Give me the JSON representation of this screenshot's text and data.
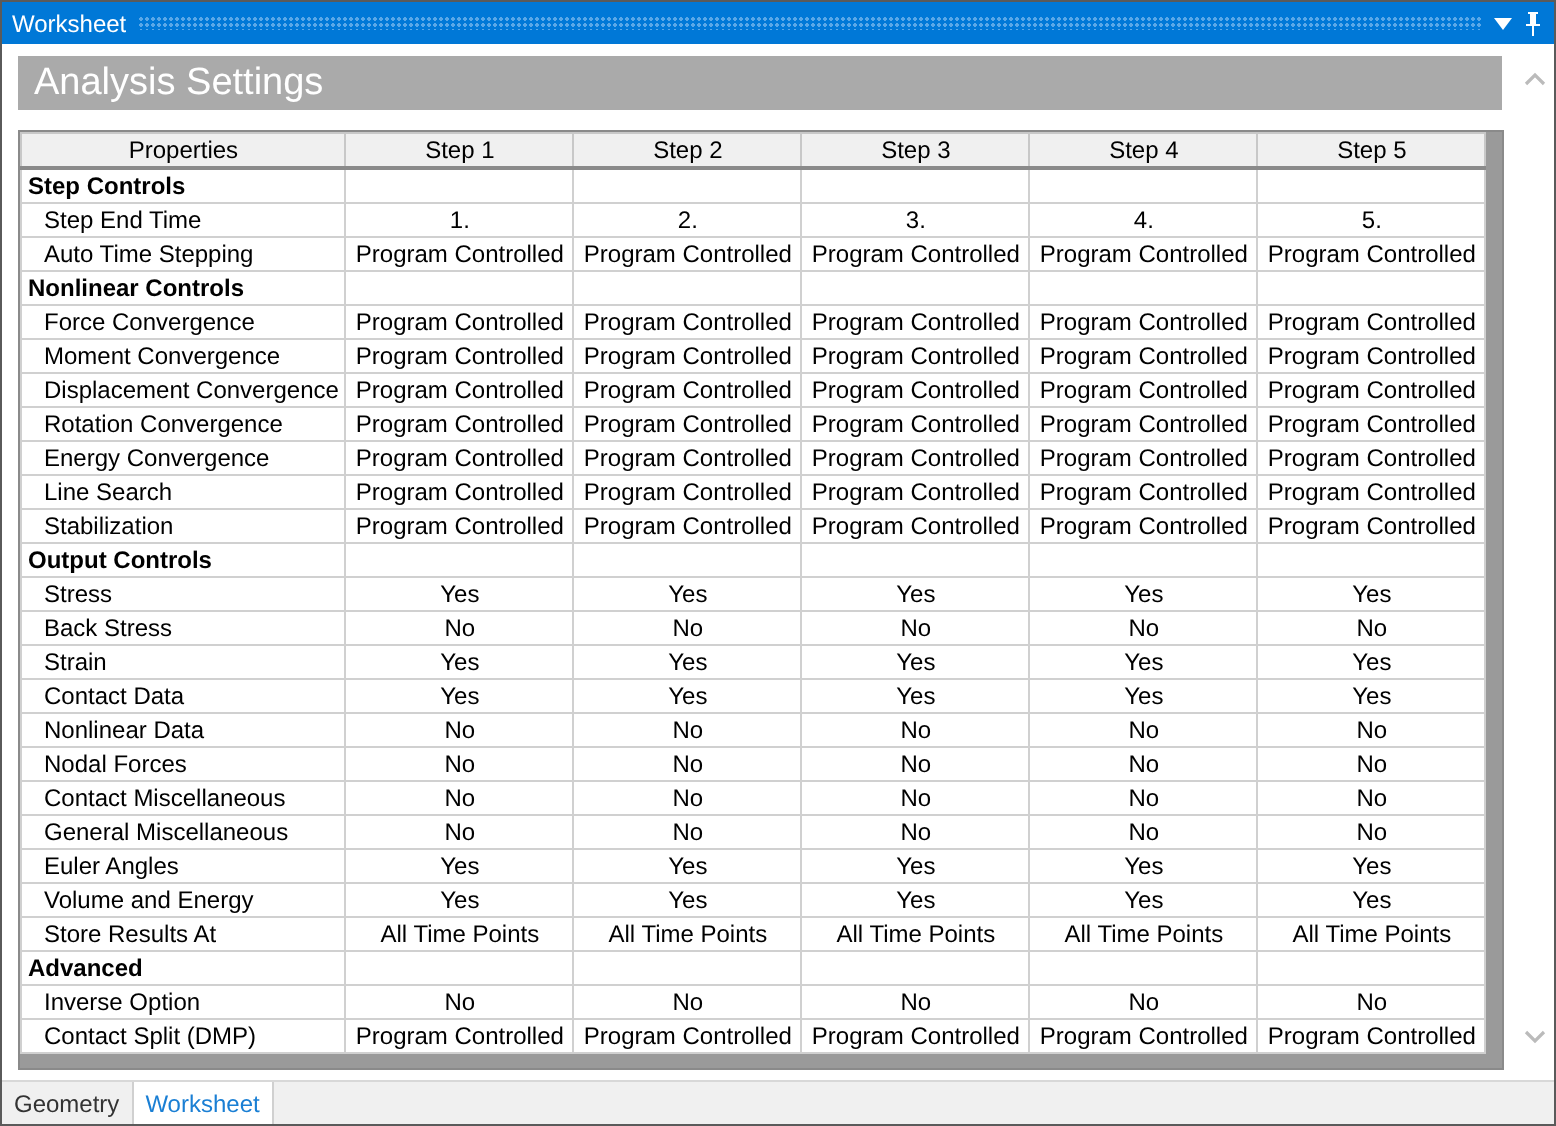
{
  "window": {
    "title": "Worksheet"
  },
  "heading": "Analysis Settings",
  "table": {
    "columns": [
      "Properties",
      "Step 1",
      "Step 2",
      "Step 3",
      "Step 4",
      "Step 5"
    ],
    "sections": [
      {
        "title": "Step Controls",
        "rows": [
          {
            "label": "Step End Time",
            "cells": [
              "1.",
              "2.",
              "3.",
              "4.",
              "5."
            ]
          },
          {
            "label": "Auto Time Stepping",
            "cells": [
              "Program Controlled",
              "Program Controlled",
              "Program Controlled",
              "Program Controlled",
              "Program Controlled"
            ]
          }
        ]
      },
      {
        "title": "Nonlinear Controls",
        "rows": [
          {
            "label": "Force Convergence",
            "cells": [
              "Program Controlled",
              "Program Controlled",
              "Program Controlled",
              "Program Controlled",
              "Program Controlled"
            ]
          },
          {
            "label": "Moment Convergence",
            "cells": [
              "Program Controlled",
              "Program Controlled",
              "Program Controlled",
              "Program Controlled",
              "Program Controlled"
            ]
          },
          {
            "label": "Displacement Convergence",
            "cells": [
              "Program Controlled",
              "Program Controlled",
              "Program Controlled",
              "Program Controlled",
              "Program Controlled"
            ]
          },
          {
            "label": "Rotation Convergence",
            "cells": [
              "Program Controlled",
              "Program Controlled",
              "Program Controlled",
              "Program Controlled",
              "Program Controlled"
            ]
          },
          {
            "label": "Energy Convergence",
            "cells": [
              "Program Controlled",
              "Program Controlled",
              "Program Controlled",
              "Program Controlled",
              "Program Controlled"
            ]
          },
          {
            "label": "Line Search",
            "cells": [
              "Program Controlled",
              "Program Controlled",
              "Program Controlled",
              "Program Controlled",
              "Program Controlled"
            ]
          },
          {
            "label": "Stabilization",
            "cells": [
              "Program Controlled",
              "Program Controlled",
              "Program Controlled",
              "Program Controlled",
              "Program Controlled"
            ]
          }
        ]
      },
      {
        "title": "Output Controls",
        "rows": [
          {
            "label": "Stress",
            "cells": [
              "Yes",
              "Yes",
              "Yes",
              "Yes",
              "Yes"
            ]
          },
          {
            "label": "Back Stress",
            "cells": [
              "No",
              "No",
              "No",
              "No",
              "No"
            ]
          },
          {
            "label": "Strain",
            "cells": [
              "Yes",
              "Yes",
              "Yes",
              "Yes",
              "Yes"
            ]
          },
          {
            "label": "Contact Data",
            "cells": [
              "Yes",
              "Yes",
              "Yes",
              "Yes",
              "Yes"
            ]
          },
          {
            "label": "Nonlinear Data",
            "cells": [
              "No",
              "No",
              "No",
              "No",
              "No"
            ]
          },
          {
            "label": "Nodal Forces",
            "cells": [
              "No",
              "No",
              "No",
              "No",
              "No"
            ]
          },
          {
            "label": "Contact Miscellaneous",
            "cells": [
              "No",
              "No",
              "No",
              "No",
              "No"
            ]
          },
          {
            "label": "General Miscellaneous",
            "cells": [
              "No",
              "No",
              "No",
              "No",
              "No"
            ]
          },
          {
            "label": "Euler Angles",
            "cells": [
              "Yes",
              "Yes",
              "Yes",
              "Yes",
              "Yes"
            ]
          },
          {
            "label": "Volume and Energy",
            "cells": [
              "Yes",
              "Yes",
              "Yes",
              "Yes",
              "Yes"
            ]
          },
          {
            "label": "Store Results At",
            "cells": [
              "All Time Points",
              "All Time Points",
              "All Time Points",
              "All Time Points",
              "All Time Points"
            ]
          }
        ]
      },
      {
        "title": "Advanced",
        "rows": [
          {
            "label": "Inverse Option",
            "cells": [
              "No",
              "No",
              "No",
              "No",
              "No"
            ]
          },
          {
            "label": "Contact Split (DMP)",
            "cells": [
              "Program Controlled",
              "Program Controlled",
              "Program Controlled",
              "Program Controlled",
              "Program Controlled"
            ]
          }
        ]
      }
    ]
  },
  "tabs": [
    {
      "label": "Geometry",
      "selected": false
    },
    {
      "label": "Worksheet",
      "selected": true
    }
  ]
}
